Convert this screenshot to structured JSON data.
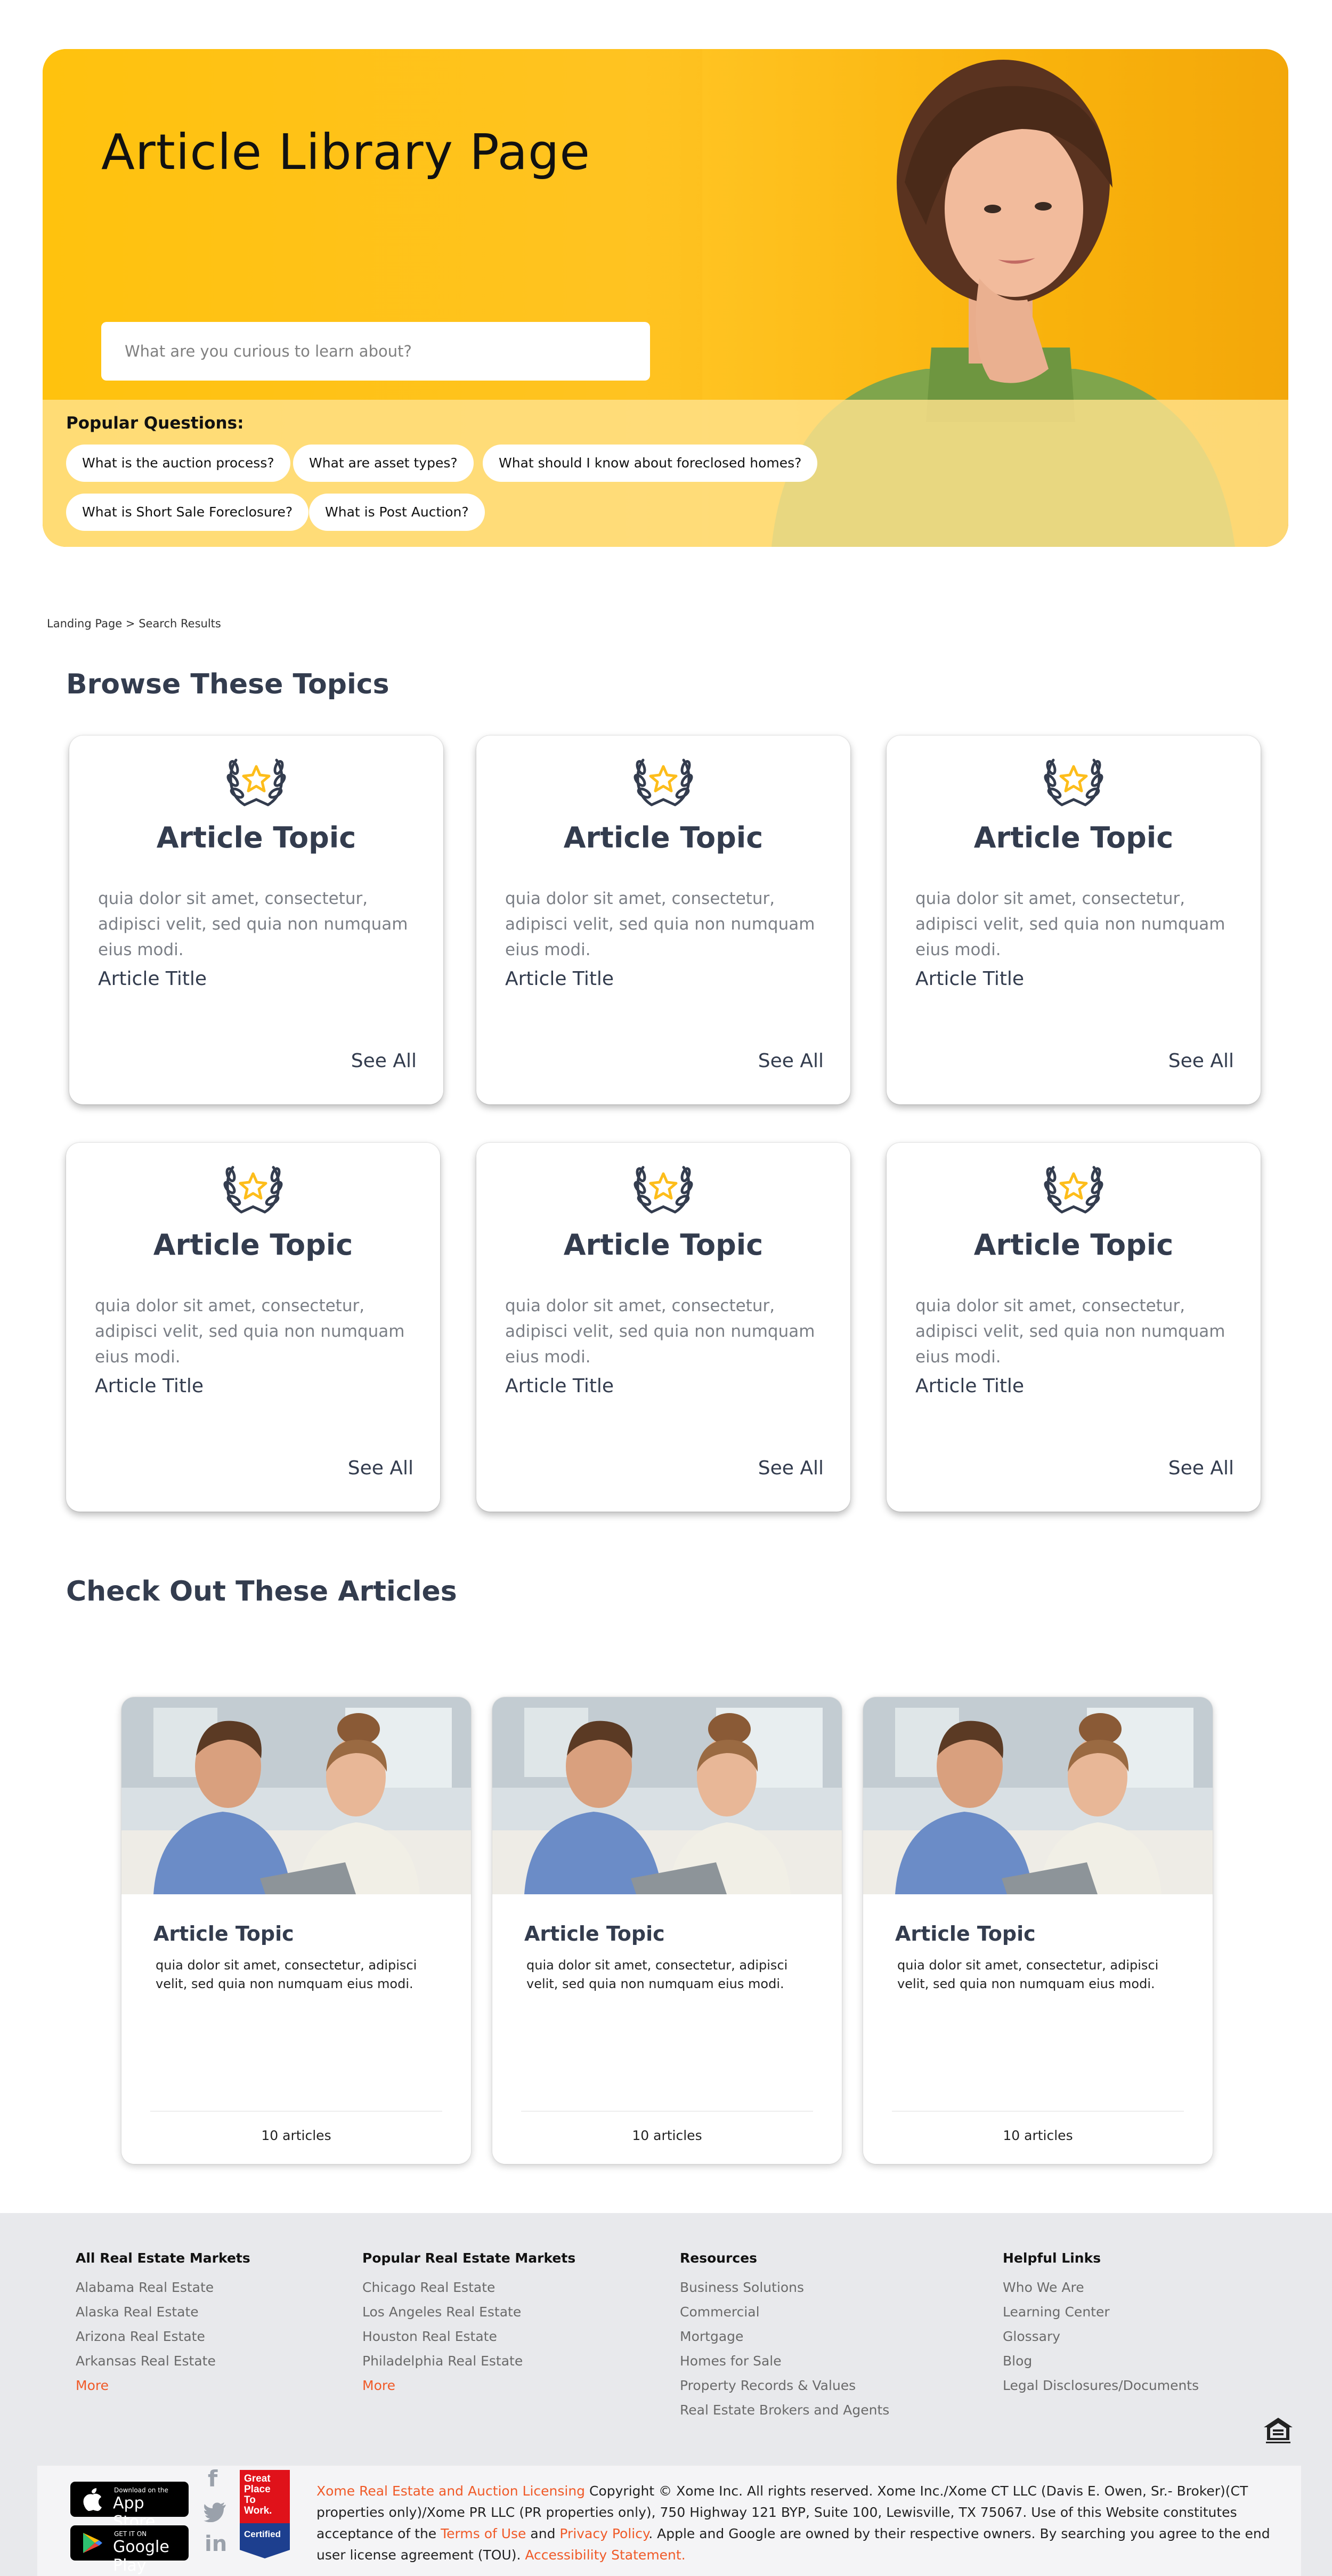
{
  "hero": {
    "title": "Article Library Page",
    "search_placeholder": "What are you curious to learn about?",
    "popular_heading": "Popular Questions:",
    "questions": [
      "What is the auction process?",
      "What are asset types?",
      "What should I know about foreclosed homes?",
      "What is Short Sale Foreclosure?",
      "What is Post Auction?"
    ],
    "accent_color": "#fdbd1b"
  },
  "breadcrumb": {
    "home": "Landing Page",
    "separator": ">",
    "current": "Search Results"
  },
  "topics_section": {
    "title": "Browse These Topics",
    "cards": [
      {
        "topic": "Article Topic",
        "desc": "quia dolor sit amet, consectetur, adipisci velit, sed quia non numquam eius modi.",
        "article_title": "Article Title",
        "see_all": "See All",
        "icon": "laurel-star-icon"
      },
      {
        "topic": "Article Topic",
        "desc": "quia dolor sit amet, consectetur, adipisci velit, sed quia non numquam eius modi.",
        "article_title": "Article Title",
        "see_all": "See All",
        "icon": "laurel-star-icon"
      },
      {
        "topic": "Article Topic",
        "desc": "quia dolor sit amet, consectetur, adipisci velit, sed quia non numquam eius modi.",
        "article_title": "Article Title",
        "see_all": "See All",
        "icon": "laurel-star-icon"
      },
      {
        "topic": "Article Topic",
        "desc": "quia dolor sit amet, consectetur, adipisci velit, sed quia non numquam eius modi.",
        "article_title": "Article Title",
        "see_all": "See All",
        "icon": "laurel-star-icon"
      },
      {
        "topic": "Article Topic",
        "desc": "quia dolor sit amet, consectetur, adipisci velit, sed quia non numquam eius modi.",
        "article_title": "Article Title",
        "see_all": "See All",
        "icon": "laurel-star-icon"
      },
      {
        "topic": "Article Topic",
        "desc": "quia dolor sit amet, consectetur, adipisci velit, sed quia non numquam eius modi.",
        "article_title": "Article Title",
        "see_all": "See All",
        "icon": "laurel-star-icon"
      }
    ]
  },
  "articles_section": {
    "title": "Check Out These Articles",
    "cards": [
      {
        "topic": "Article Topic",
        "desc": "quia dolor sit amet, consectetur, adipisci velit, sed quia non numquam eius modi.",
        "count": "10 articles"
      },
      {
        "topic": "Article Topic",
        "desc": "quia dolor sit amet, consectetur, adipisci velit, sed quia non numquam eius modi.",
        "count": "10 articles"
      },
      {
        "topic": "Article Topic",
        "desc": "quia dolor sit amet, consectetur, adipisci velit, sed quia non numquam eius modi.",
        "count": "10 articles"
      }
    ]
  },
  "footer": {
    "columns": [
      {
        "heading": "All Real Estate Markets",
        "links": [
          "Alabama Real Estate",
          "Alaska Real Estate",
          "Arizona Real Estate",
          "Arkansas Real Estate"
        ],
        "more": "More"
      },
      {
        "heading": "Popular Real Estate Markets",
        "links": [
          "Chicago Real Estate",
          "Los Angeles Real Estate",
          "Houston Real Estate",
          "Philadelphia Real Estate"
        ],
        "more": "More"
      },
      {
        "heading": "Resources",
        "links": [
          "Business Solutions",
          "Commercial",
          "Mortgage",
          "Homes for Sale",
          "Property Records & Values",
          "Real Estate Brokers and Agents"
        ]
      },
      {
        "heading": "Helpful Links",
        "links": [
          "Who We Are",
          "Learning Center",
          "Glossary",
          "Blog",
          "Legal Disclosures/Documents"
        ]
      }
    ],
    "app_store": {
      "small": "Download on the",
      "big": "App Store"
    },
    "google_play": {
      "small": "GET IT ON",
      "big": "Google Play"
    },
    "gptw": {
      "line1": "Great",
      "line2": "Place",
      "line3": "To",
      "line4": "Work.",
      "certified": "Certified"
    },
    "legal": {
      "licensing": "Xome Real Estate and Auction Licensing",
      "copyright": "Copyright © Xome Inc. All rights reserved. Xome Inc./Xome CT LLC (Davis E. Owen, Sr.- Broker)(CT properties only)/Xome PR LLC (PR properties only), 750 Highway 121 BYP, Suite 100, Lewisville, TX 75067. Use of this Website constitutes acceptance of the",
      "terms": "Terms of Use",
      "and": "and",
      "privacy": "Privacy Policy",
      "apple_google": ". Apple and Google are owned by their respective owners. By searching you agree to the end user license agreement (TOU).",
      "accessibility": "Accessibility Statement."
    },
    "link_color": "#f05a28"
  }
}
